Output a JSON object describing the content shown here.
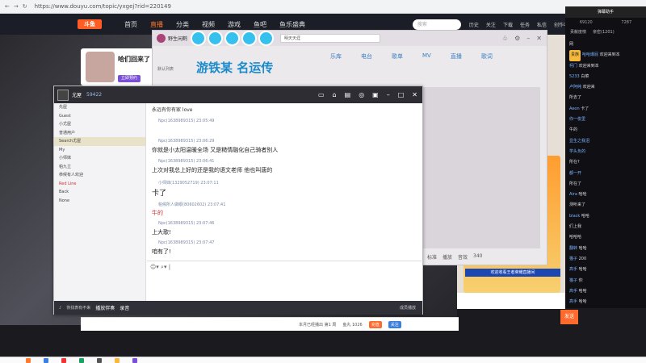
{
  "browser": {
    "url": "https://www.douyu.com/topic/yxgej?rid=220149"
  },
  "site": {
    "logo": "斗鱼",
    "nav": [
      "首页",
      "直播",
      "分类",
      "视频",
      "游戏",
      "鱼吧",
      "鱼乐盛典"
    ],
    "search_placeholder": "搜索",
    "header_icons": [
      "历史",
      "关注",
      "下载",
      "任务",
      "私信",
      "创作中心"
    ]
  },
  "banner": {
    "title": "哈们回来了",
    "button": "立即预约"
  },
  "music": {
    "username": "野生闲鹤",
    "search_value": "明天天涯",
    "title_art": "游铁某 名运传",
    "tabs": [
      "乐库",
      "电台",
      "歌单",
      "MV",
      "直播",
      "歌词"
    ],
    "list_label": "默认列表",
    "bottom": [
      "标准",
      "播放",
      "音效",
      "340"
    ]
  },
  "chat": {
    "user": "尤屋",
    "score": "59422",
    "header_line": "永远有你有家 love",
    "contacts": [
      "先屋",
      "Guest",
      "小尤屋",
      "普通用户",
      "Search尤屋",
      "My",
      "小师妹",
      "帕九立",
      "恭候有人欢迎",
      "Red Line",
      "Back",
      "None"
    ],
    "messages": [
      {
        "name": "Npc(1638989315)",
        "time": "23:05:49",
        "text": ""
      },
      {
        "name": "Npc(1638989315)",
        "time": "23:06:29",
        "text": "你就是小太阳温暖全场 又是糙情融化自己骑者别人"
      },
      {
        "name": "Npc(1638989315)",
        "time": "23:06:41",
        "text": "上次对我总上好的还是我的语文老师 他也叫唐的"
      },
      {
        "name": "小师妹(1329052719)",
        "time": "23:07:11",
        "text": "卡了"
      },
      {
        "name": "帕候所人做眼(80602602)",
        "time": "23:07:41",
        "text": "牛的"
      },
      {
        "name": "Npc(1638989315)",
        "time": "23:07:46",
        "text": "上大歌!"
      },
      {
        "name": "Npc(1638989315)",
        "time": "23:07:47",
        "text": "咱有了!"
      }
    ],
    "footer": [
      "你找表有不来",
      " 播放伴奏",
      "录音"
    ],
    "footer_right": "成员播放"
  },
  "rightchat": {
    "header": "弹幕助手",
    "stats": [
      "69120",
      "7287"
    ],
    "tabs": [
      "贡献度榜",
      "亲密(1201)"
    ],
    "lines": [
      {
        "badge": "",
        "name": "",
        "text": "网"
      },
      {
        "badge": "贵族",
        "name": "哈哈爆屁",
        "text": "欢迎来到本"
      },
      {
        "badge": "",
        "name": "柯门",
        "text": "欢迎来到本"
      },
      {
        "badge": "",
        "name": "5233",
        "text": "白菜"
      },
      {
        "badge": "",
        "name": "卢阿纯",
        "text": "欢迎来"
      },
      {
        "badge": "",
        "name": "",
        "text": "所去了"
      },
      {
        "badge": "",
        "name": "Aeon",
        "text": "卡了"
      },
      {
        "badge": "",
        "name": "你一俊里",
        "text": ""
      },
      {
        "badge": "",
        "name": "",
        "text": "牛的"
      },
      {
        "badge": "",
        "name": "显生之我泪",
        "text": ""
      },
      {
        "badge": "",
        "name": "学头负的",
        "text": ""
      },
      {
        "badge": "",
        "name": "",
        "text": "所在?"
      },
      {
        "badge": "",
        "name": "都一开",
        "text": ""
      },
      {
        "badge": "",
        "name": "",
        "text": "所在了"
      },
      {
        "badge": "",
        "name": "Aira",
        "text": "哈哈"
      },
      {
        "badge": "",
        "name": "",
        "text": "测听来了"
      },
      {
        "badge": "",
        "name": "black",
        "text": "哈哈"
      },
      {
        "badge": "",
        "name": "",
        "text": "们上我"
      },
      {
        "badge": "",
        "name": "",
        "text": "哈哈哈"
      },
      {
        "badge": "",
        "name": "翻转",
        "text": "哈哈"
      },
      {
        "badge": "",
        "name": "猫子",
        "text": "200"
      },
      {
        "badge": "",
        "name": "高手",
        "text": "哈哈"
      },
      {
        "badge": "",
        "name": "猫子",
        "text": "你"
      },
      {
        "badge": "",
        "name": "高手",
        "text": "哈哈"
      },
      {
        "badge": "",
        "name": "高手",
        "text": "哈哈"
      }
    ]
  },
  "promo": {
    "live": "欢迎收看王者荣耀直播间",
    "send": "发送"
  },
  "bottomstrip": {
    "text": "本月已经播出 第1 周",
    "fish": "鱼丸 1026",
    "btn1": "充值",
    "btn2": "关注"
  }
}
